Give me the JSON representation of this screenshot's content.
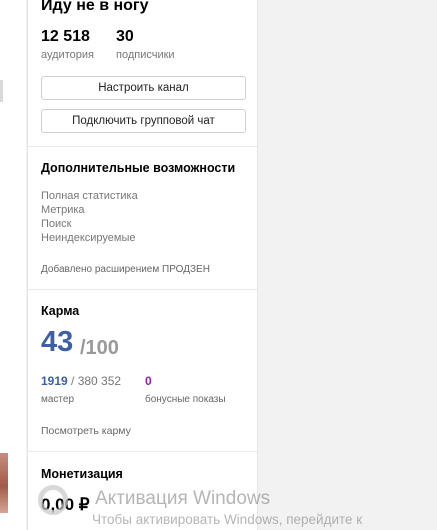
{
  "channel": {
    "title": "Иду не в ногу",
    "audience_value": "12 518",
    "audience_label": "аудитория",
    "subscribers_value": "30",
    "subscribers_label": "подписчики",
    "setup_button": "Настроить канал",
    "group_chat_button": "Подключить групповой чат"
  },
  "features": {
    "title": "Дополнительные возможности",
    "items": [
      "Полная статистика",
      "Метрика",
      "Поиск",
      "Неиндексируемые"
    ],
    "note": "Добавлено расширением ПРОДЗЕН"
  },
  "karma": {
    "title": "Карма",
    "value": "43",
    "max": "/100",
    "rank_value": "1919",
    "rank_total": " / 380 352",
    "rank_label": "мастер",
    "bonus_value": "0",
    "bonus_label": "бонусные показы",
    "link": "Посмотреть карму",
    "colors": {
      "value": "#3d5fa8",
      "bonus": "#8e24aa"
    }
  },
  "monetization": {
    "title": "Монетизация",
    "amount": "0,00 ₽"
  },
  "watermark": {
    "title": "Активация Windows",
    "text": "Чтобы активировать Windows, перейдите к"
  }
}
